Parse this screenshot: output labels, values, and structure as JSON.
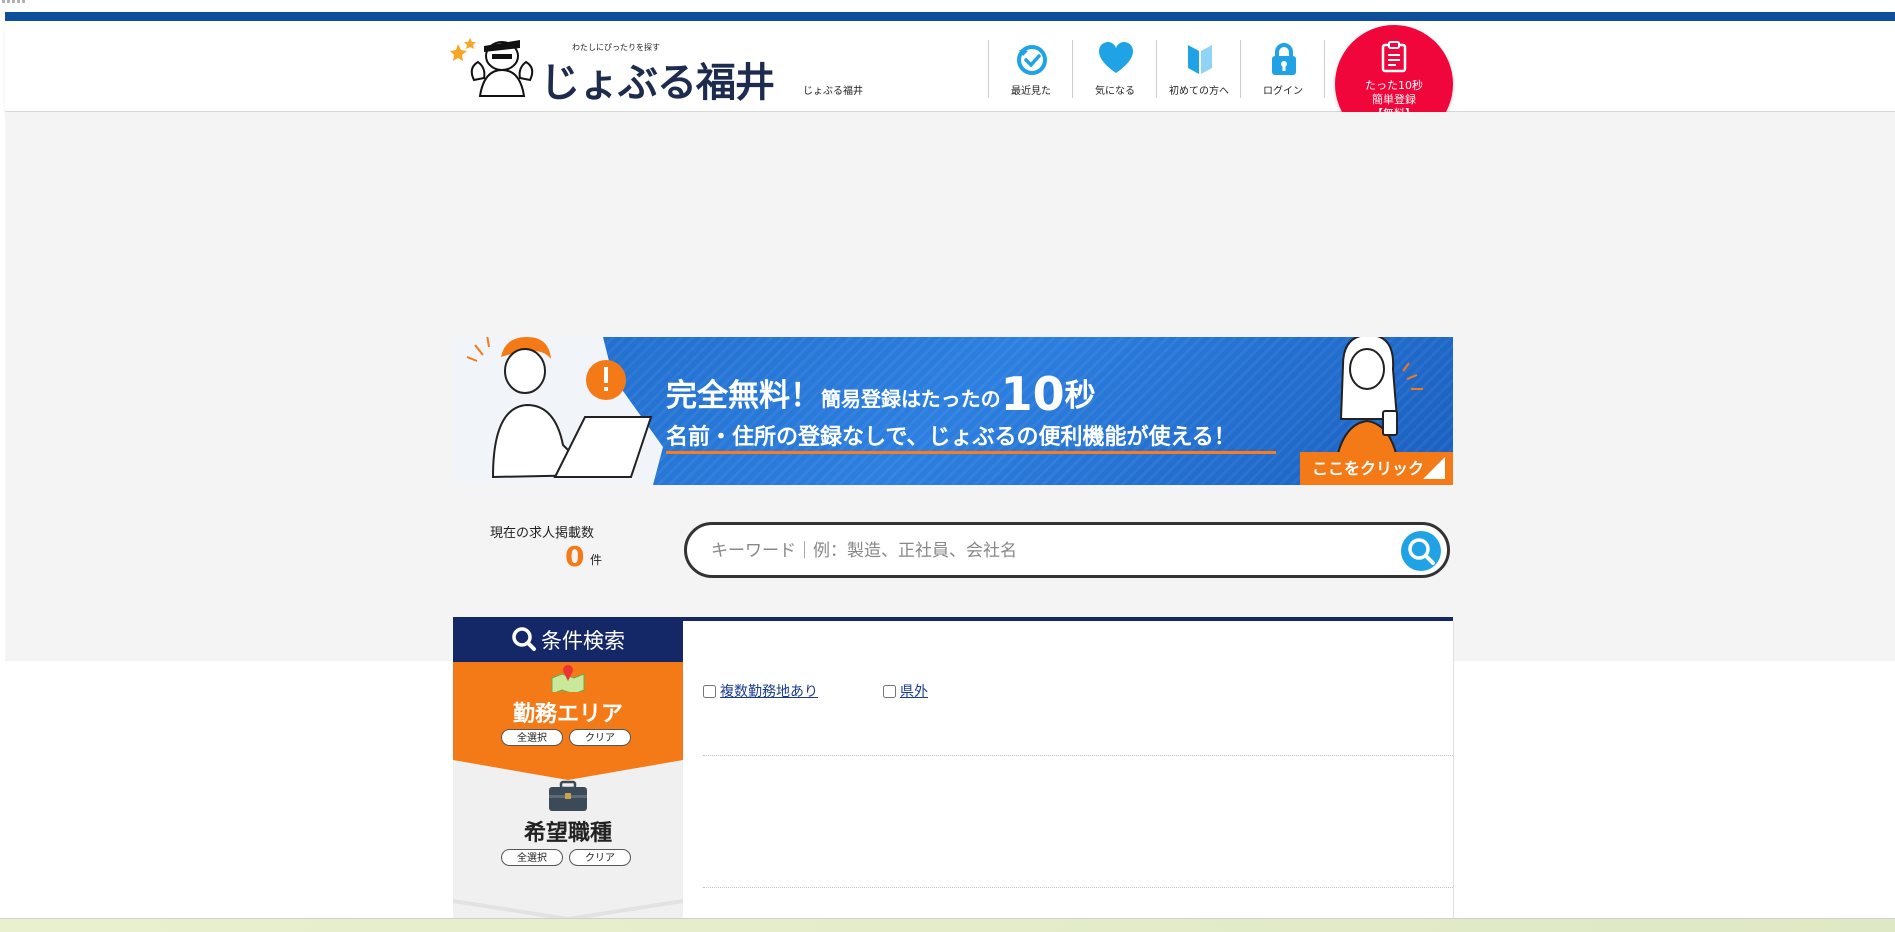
{
  "header": {
    "logo_tagline": "わたしにぴったりを探す",
    "logo_text": "じょぶる福井",
    "site_subtitle": "じょぶる福井",
    "nav": [
      {
        "label": "最近見た",
        "icon": "clock-check-icon"
      },
      {
        "label": "気になる",
        "icon": "heart-icon"
      },
      {
        "label": "初めての方へ",
        "icon": "beginner-mark-icon"
      },
      {
        "label": "ログイン",
        "icon": "lock-icon"
      }
    ],
    "register": {
      "line1": "たった10秒",
      "line2": "簡単登録",
      "line3": "【無料】"
    }
  },
  "banner": {
    "part1": "完全無料！",
    "part2": "簡易登録はたったの",
    "part3": "10",
    "part4": "秒",
    "line2": "名前・住所の登録なしで、じょぶるの便利機能が使える！",
    "click_label": "ここをクリック"
  },
  "count": {
    "label": "現在の求人掲載数",
    "value": "0",
    "unit": "件"
  },
  "search": {
    "placeholder": "キーワード｜例：製造、正社員、会社名"
  },
  "conditions": {
    "title": "条件検索",
    "area": {
      "label": "勤務エリア",
      "select_all": "全選択",
      "clear": "クリア"
    },
    "job": {
      "label": "希望職種",
      "select_all": "全選択",
      "clear": "クリア"
    },
    "checkboxes": [
      {
        "label": "複数勤務地あり",
        "checked": false
      },
      {
        "label": "県外",
        "checked": false
      }
    ]
  },
  "colors": {
    "brand_blue": "#0e4f9b",
    "navy": "#142867",
    "orange": "#f47a18",
    "register_red": "#f0063a",
    "icon_blue": "#1fa3e6"
  }
}
